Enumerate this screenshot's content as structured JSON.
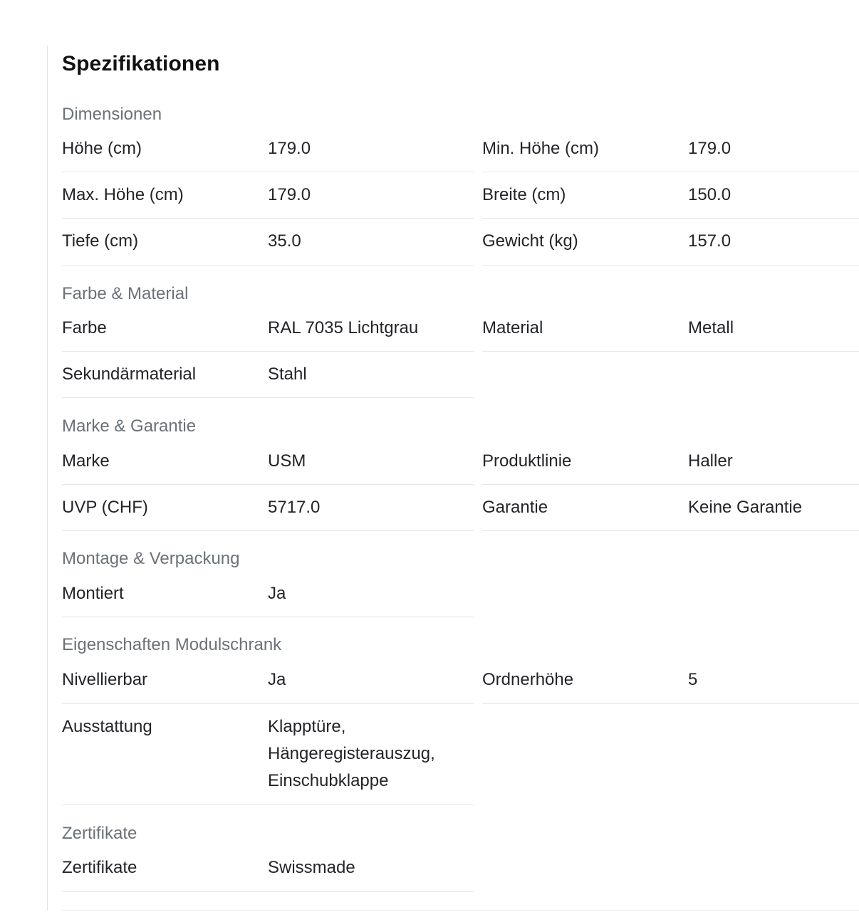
{
  "title": "Spezifikationen",
  "groups": {
    "dimensionen": {
      "title": "Dimensionen",
      "rows": [
        {
          "label": "Höhe (cm)",
          "value": "179.0"
        },
        {
          "label": "Min. Höhe (cm)",
          "value": "179.0"
        },
        {
          "label": "Max. Höhe (cm)",
          "value": "179.0"
        },
        {
          "label": "Breite (cm)",
          "value": "150.0"
        },
        {
          "label": "Tiefe (cm)",
          "value": "35.0"
        },
        {
          "label": "Gewicht (kg)",
          "value": "157.0"
        }
      ]
    },
    "farbe": {
      "title": "Farbe & Material",
      "rows": [
        {
          "label": "Farbe",
          "value": "RAL 7035 Lichtgrau"
        },
        {
          "label": "Material",
          "value": "Metall"
        },
        {
          "label": "Sekundärmaterial",
          "value": "Stahl"
        }
      ]
    },
    "marke": {
      "title": "Marke & Garantie",
      "rows": [
        {
          "label": "Marke",
          "value": "USM"
        },
        {
          "label": "Produktlinie",
          "value": "Haller"
        },
        {
          "label": "UVP (CHF)",
          "value": "5717.0"
        },
        {
          "label": "Garantie",
          "value": "Keine Garantie"
        }
      ]
    },
    "montage": {
      "title": "Montage & Verpackung",
      "rows": [
        {
          "label": "Montiert",
          "value": "Ja"
        }
      ]
    },
    "eigenschaften": {
      "title": "Eigenschaften Modulschrank",
      "rows": [
        {
          "label": "Nivellierbar",
          "value": "Ja"
        },
        {
          "label": "Ordnerhöhe",
          "value": "5"
        },
        {
          "label": "Ausstattung",
          "value": "Klapptüre, Hängeregisterauszug, Einschubklappe"
        }
      ]
    },
    "zertifikate": {
      "title": "Zertifikate",
      "rows": [
        {
          "label": "Zertifikate",
          "value": "Swissmade"
        }
      ]
    }
  }
}
